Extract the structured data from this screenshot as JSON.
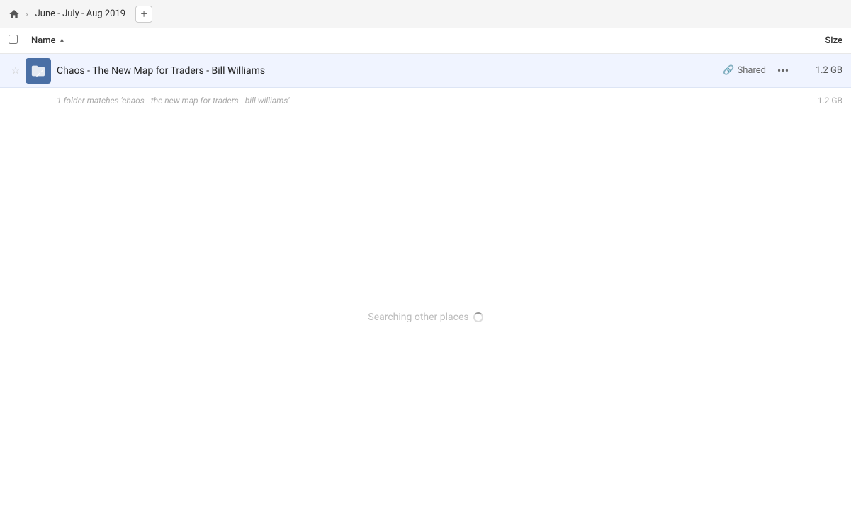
{
  "breadcrumb": {
    "home_icon": "home",
    "chevron": "›",
    "label": "June - July - Aug 2019",
    "add_button_label": "+"
  },
  "columns": {
    "name_label": "Name",
    "sort_arrow": "▲",
    "size_label": "Size"
  },
  "file_row": {
    "star_icon": "☆",
    "folder_icon": "folder-pencil",
    "name": "Chaos - The New Map for Traders - Bill Williams",
    "shared_label": "Shared",
    "more_icon": "•••",
    "size": "1.2 GB"
  },
  "match_info": {
    "text": "1 folder matches 'chaos - the new map for traders - bill williams'",
    "size": "1.2 GB"
  },
  "searching": {
    "text": "Searching other places"
  }
}
